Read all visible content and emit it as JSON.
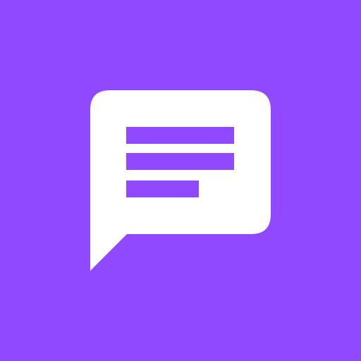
{
  "icon": {
    "name": "chat-message-icon",
    "background_color": "#9149FF",
    "bubble_color": "#FFFFFF",
    "lines_color": "#9149FF"
  }
}
